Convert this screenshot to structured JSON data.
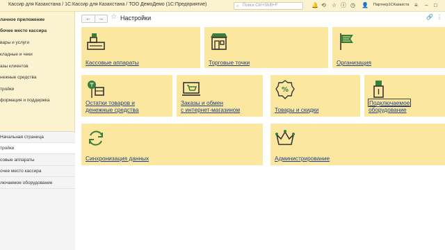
{
  "titlebar": {
    "title": "Кассир для Казахстана / 1С:Кассир для Казахстана / ТОО ДемоДемо  (1С:Предприятие)",
    "search_placeholder": "Поиск Ctrl+Shift+F",
    "user": "Партнер1СКазахста"
  },
  "sidebar": {
    "items": [
      {
        "label": "лачное приложение",
        "bold": true
      },
      {
        "label": "бочее место кассира",
        "bold": true
      },
      {
        "label": "вары и услуги"
      },
      {
        "label": "кладные и чеки"
      },
      {
        "label": "азы клиентов"
      },
      {
        "label": "нежные средства"
      },
      {
        "label": "тройки"
      },
      {
        "label": "формация и поддержка"
      }
    ],
    "open": [
      {
        "label": "Начальная страница"
      },
      {
        "label": "тройки",
        "active": true
      },
      {
        "label": "совые аппараты"
      },
      {
        "label": "очее место кассира"
      },
      {
        "label": "лючаемое оборудование"
      }
    ]
  },
  "header": {
    "back": "←",
    "forward": "→",
    "title": "Настройки"
  },
  "tiles": [
    {
      "label": "Кассовые аппараты",
      "icon": "cash-register-icon"
    },
    {
      "label": "Торговые точки",
      "icon": "store-icon"
    },
    {
      "label": "Организация",
      "icon": "organization-flag-icon"
    },
    {
      "label": "Остатки товаров и",
      "label2": "денежные средства",
      "icon": "balances-icon"
    },
    {
      "label": "Заказы и обмен",
      "label2": "с интернет-магазином",
      "icon": "online-store-icon"
    },
    {
      "label": "Товары и скидки",
      "icon": "discount-icon"
    },
    {
      "label": "Подключаемое",
      "label2": "оборудование",
      "icon": "usb-device-icon"
    },
    {
      "label": "Синхронизация данных",
      "icon": "sync-icon"
    },
    {
      "label": "Администрирование",
      "icon": "crown-icon"
    }
  ],
  "colors": {
    "tile_bg": "#fbe7a0",
    "sidebar_bg": "#fbf3d0",
    "link": "#1e3f8a",
    "icon_green": "#3b7d3a"
  }
}
